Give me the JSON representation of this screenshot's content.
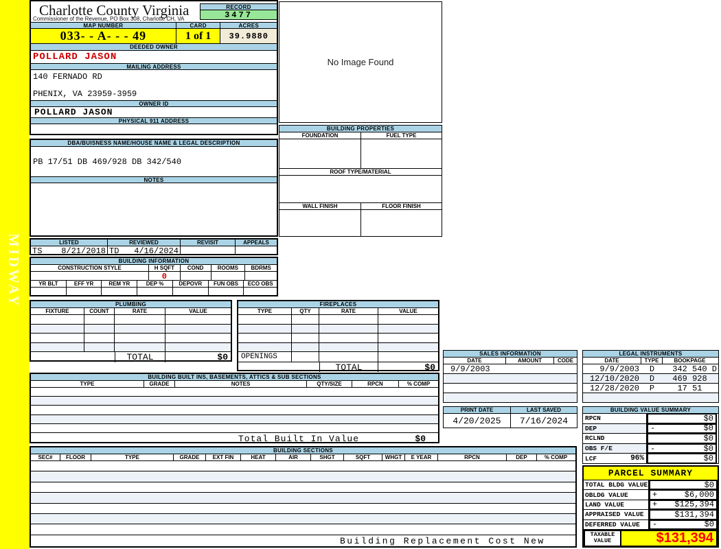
{
  "sidebar": {
    "district": "MIDWAY"
  },
  "header": {
    "county_title": "Charlotte County Virginia",
    "commissioner_line": "Commissioner of the Revenue, PO Box 308, Charlotte CH, VA",
    "record_label": "RECORD",
    "record_number": "3477",
    "map_number_label": "MAP NUMBER",
    "map_number": "033- - A- - - 49",
    "card_label": "CARD",
    "card": "1 of 1",
    "acres_label": "ACRES",
    "acres": "39.9880"
  },
  "owner": {
    "deeded_owner_label": "DEEDED OWNER",
    "deeded_owner": "POLLARD JASON",
    "mailing_address_label": "MAILING ADDRESS",
    "mailing_address_line1": "140 FERNADO RD",
    "mailing_address_line2": "PHENIX, VA 23959-3959",
    "owner_id_label": "OWNER ID",
    "owner_id": "POLLARD JASON",
    "physical_address_label": "PHYSICAL 911 ADDRESS",
    "physical_address": ""
  },
  "legal": {
    "dba_label": "DBA/BUISNESS NAME/HOUSE NAME & LEGAL DESCRIPTION",
    "description": "PB 17/51 DB 469/928 DB 342/540",
    "notes_label": "NOTES",
    "notes": ""
  },
  "visits": {
    "headers": [
      "LISTED",
      "REVIEWED",
      "REVISIT",
      "APPEALS"
    ],
    "listed_by": "TS",
    "listed_date": "8/21/2018",
    "reviewed_by": "TD",
    "reviewed_date": "4/16/2024",
    "revisit": "",
    "appeals": ""
  },
  "photo": {
    "placeholder": "No Image Found"
  },
  "building_properties": {
    "title": "BUILDING PROPERTIES",
    "foundation_label": "FOUNDATION",
    "fuel_type_label": "FUEL TYPE",
    "roof_label": "ROOF TYPE/MATERIAL",
    "wall_finish_label": "WALL FINISH",
    "floor_finish_label": "FLOOR FINISH"
  },
  "building_information": {
    "title": "BUILDING INFORMATION",
    "row1_headers": [
      "CONSTRUCTION STYLE",
      "H SQFT",
      "COND",
      "ROOMS",
      "BDRMS"
    ],
    "h_sqft": "0",
    "row2_headers": [
      "YR BLT",
      "EFF YR",
      "REM YR",
      "DEP %",
      "DEPOVR",
      "FUN OBS",
      "ECO OBS"
    ]
  },
  "plumbing": {
    "title": "PLUMBING",
    "headers": [
      "FIXTURE",
      "COUNT",
      "RATE",
      "VALUE"
    ],
    "total_label": "TOTAL",
    "total_value": "$0"
  },
  "fireplaces": {
    "title": "FIREPLACES",
    "headers": [
      "TYPE",
      "QTY",
      "RATE",
      "VALUE"
    ],
    "openings_label": "OPENINGS",
    "total_label": "TOTAL",
    "total_value": "$0"
  },
  "built_ins": {
    "title": "BUILDING BUILT INS, BASEMENTS, ATTICS & SUB SECTIONS",
    "headers": [
      "TYPE",
      "GRADE",
      "NOTES",
      "QTY/SIZE",
      "RPCN",
      "% COMP"
    ],
    "total_label": "Total Built In Value",
    "total_value": "$0"
  },
  "building_sections": {
    "title": "BUILDING SECTIONS",
    "headers": [
      "SEC#",
      "FLOOR",
      "TYPE",
      "GRADE",
      "EXT FIN",
      "HEAT",
      "AIR",
      "SHGT",
      "SQFT",
      "WHGT",
      "E YEAR",
      "RPCN",
      "DEP",
      "% COMP"
    ],
    "footer": "Building Replacement Cost New"
  },
  "sales": {
    "title": "SALES INFORMATION",
    "headers": [
      "DATE",
      "AMOUNT",
      "CODE"
    ],
    "rows": [
      [
        "9/9/2003",
        "",
        ""
      ],
      [
        "",
        "",
        ""
      ],
      [
        "",
        "",
        ""
      ],
      [
        "",
        "",
        ""
      ]
    ]
  },
  "legal_instruments": {
    "title": "LEGAL INSTRUMENTS",
    "headers": [
      "DATE",
      "TYPE",
      "BOOKPAGE"
    ],
    "rows": [
      [
        "9/9/2003",
        "D",
        "342 540 D"
      ],
      [
        "12/10/2020",
        "D",
        "469 928"
      ],
      [
        "12/28/2020",
        "P",
        "17 51"
      ],
      [
        "",
        "",
        ""
      ]
    ]
  },
  "dates": {
    "print_date_label": "PRINT DATE",
    "print_date": "4/20/2025",
    "last_saved_label": "LAST SAVED",
    "last_saved": "7/16/2024"
  },
  "building_value_summary": {
    "title": "BUILDING VALUE SUMMARY",
    "rows": [
      {
        "label": "RPCN",
        "pct": "",
        "op": "",
        "value": "$0"
      },
      {
        "label": "DEP",
        "pct": "",
        "op": "-",
        "value": "$0"
      },
      {
        "label": "RCLND",
        "pct": "",
        "op": "",
        "value": "$0"
      },
      {
        "label": "OBS F/E",
        "pct": "",
        "op": "-",
        "value": "$0"
      },
      {
        "label": "LCF",
        "pct": "96%",
        "op": "",
        "value": "$0"
      }
    ]
  },
  "parcel_summary": {
    "title": "PARCEL SUMMARY",
    "rows": [
      {
        "label": "TOTAL BLDG VALUE",
        "op": "",
        "value": "$0"
      },
      {
        "label": "OBLDG VALUE",
        "op": "+",
        "value": "$6,000"
      },
      {
        "label": "LAND VALUE",
        "op": "+",
        "value": "$125,394"
      },
      {
        "label": "APPRAISED VALUE",
        "op": "",
        "value": "$131,394"
      },
      {
        "label": "DEFERRED VALUE",
        "op": "-",
        "value": "$0"
      }
    ],
    "taxable_label_line1": "TAXABLE",
    "taxable_label_line2": "VALUE",
    "taxable_value": "$131,394"
  },
  "colors": {
    "header_blue": "#AAD4E6",
    "record_green": "#98E698",
    "highlight_yellow": "#FFFF00",
    "acres_cream": "#F1ECD8",
    "owner_red": "#CC0000",
    "taxable_red": "#FF0000",
    "row_alt": "#EDF2F8"
  }
}
